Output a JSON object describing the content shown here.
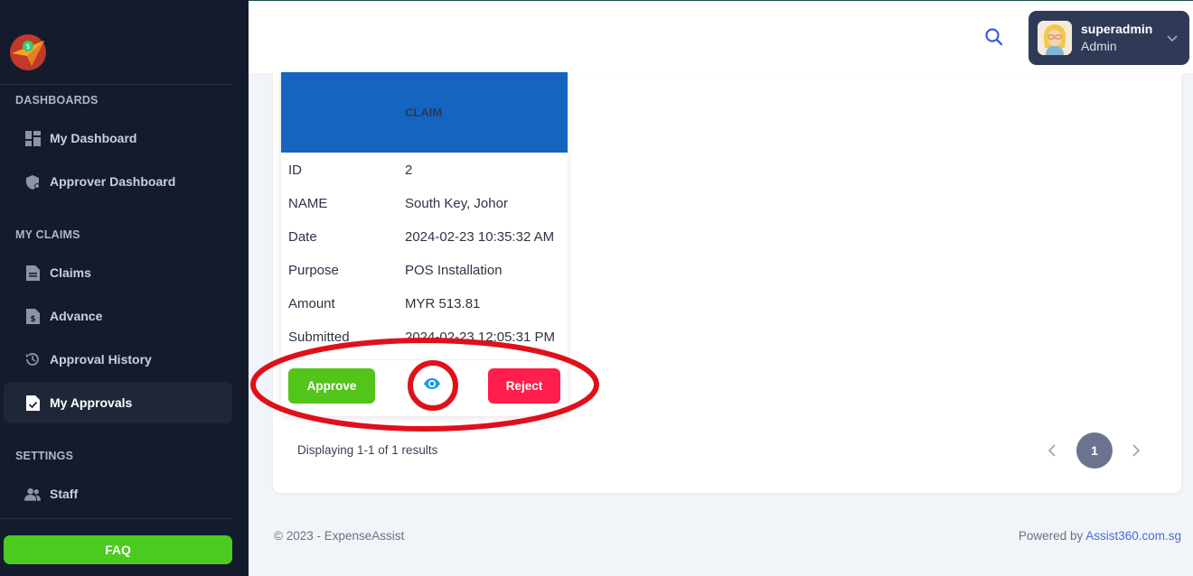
{
  "sidebar": {
    "sections": [
      {
        "title": "DASHBOARDS"
      },
      {
        "title": "MY CLAIMS"
      },
      {
        "title": "SETTINGS"
      }
    ],
    "items": [
      {
        "label": "My Dashboard",
        "icon": "dashboard-icon"
      },
      {
        "label": "Approver Dashboard",
        "icon": "shield-icon"
      },
      {
        "label": "Claims",
        "icon": "document-icon"
      },
      {
        "label": "Advance",
        "icon": "dollar-document-icon"
      },
      {
        "label": "Approval History",
        "icon": "history-icon"
      },
      {
        "label": "My Approvals",
        "icon": "approved-document-icon",
        "active": true
      },
      {
        "label": "Staff",
        "icon": "users-icon"
      }
    ],
    "faq_label": "FAQ"
  },
  "header": {
    "user": {
      "name": "superadmin",
      "role": "Admin"
    }
  },
  "claim": {
    "header": "CLAIM",
    "fields": [
      {
        "key": "ID",
        "value": "2"
      },
      {
        "key": "NAME",
        "value": "South Key, Johor"
      },
      {
        "key": "Date",
        "value": "2024-02-23 10:35:32 AM"
      },
      {
        "key": "Purpose",
        "value": "POS Installation"
      },
      {
        "key": "Amount",
        "value": "MYR 513.81"
      },
      {
        "key": "Submitted",
        "value": "2024-02-23 12:05:31 PM"
      }
    ],
    "approve_label": "Approve",
    "reject_label": "Reject"
  },
  "pagination": {
    "summary": "Displaying 1-1 of 1 results",
    "current_page": "1"
  },
  "footer": {
    "copyright": "© 2023 - ExpenseAssist",
    "powered_prefix": "Powered by ",
    "powered_link": "Assist360.com.sg"
  },
  "colors": {
    "sidebar_bg": "#141b2d",
    "claim_header": "#1565c0",
    "approve": "#52c41a",
    "reject": "#ff1e4c",
    "faq": "#4bcb1f",
    "annotation": "#e0101b"
  }
}
